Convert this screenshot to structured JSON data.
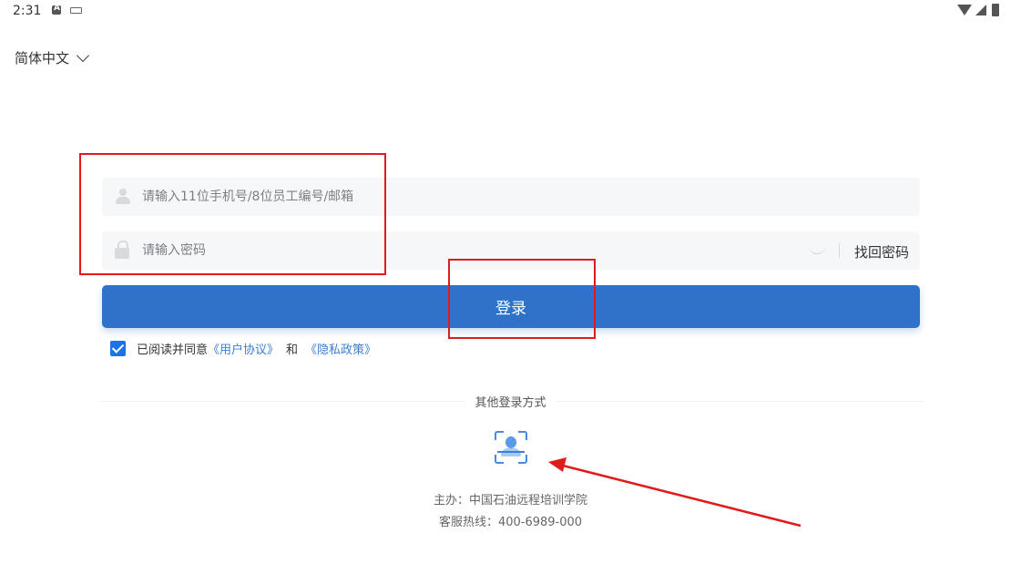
{
  "status_bar": {
    "time": "2:31",
    "icons": [
      "a-icon",
      "keyboard-icon",
      "wifi-icon",
      "signal-icon",
      "battery-icon"
    ]
  },
  "language_select": {
    "value": "简体中文"
  },
  "login_form": {
    "account_placeholder": "请输入11位手机号/8位员工编号/邮箱",
    "password_placeholder": "请输入密码",
    "forgot_password": "找回密码",
    "login_button": "登录"
  },
  "agreement": {
    "checked": true,
    "prefix": "已阅读并同意",
    "user_agreement": "《用户协议》",
    "and": "和",
    "privacy_policy": "《隐私政策》"
  },
  "other_login": {
    "label": "其他登录方式",
    "method_icon": "face-recognition-icon"
  },
  "footer": {
    "organizer": "主办：中国石油远程培训学院",
    "hotline": "客服热线：400-6989-000"
  },
  "colors": {
    "primary": "#2e72c9",
    "link": "#3b7fd1",
    "annotation": "#e01b1b"
  }
}
